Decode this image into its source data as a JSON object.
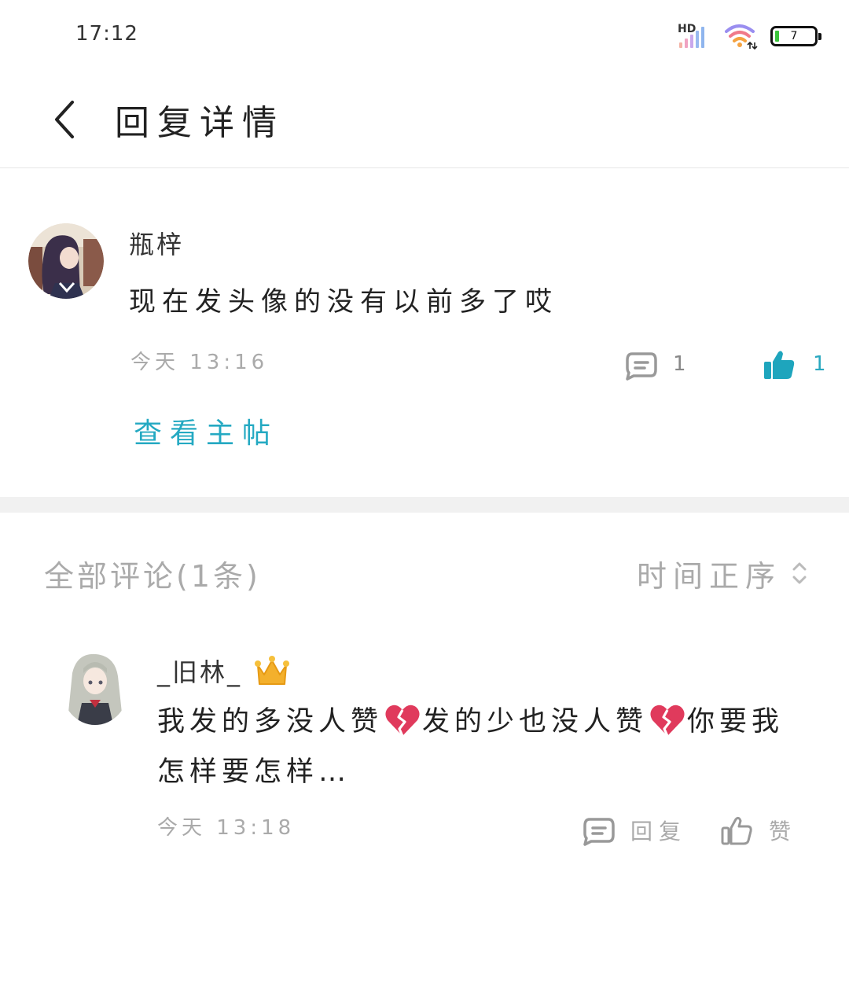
{
  "status_bar": {
    "time": "17:12",
    "network": "HD",
    "battery": "7"
  },
  "header": {
    "title": "回复详情"
  },
  "reply": {
    "author": "瓶梓",
    "text": "现在发头像的没有以前多了哎",
    "time": "今天 13:16",
    "comment_count": "1",
    "like_count": "1",
    "view_main_post": "查看主帖"
  },
  "comments_section": {
    "heading": "全部评论(1条)",
    "sort": "时间正序"
  },
  "comments": [
    {
      "author": "_旧林_",
      "badge_icon": "crown-icon",
      "text_part1": "我发的多没人赞",
      "text_part2": "发的少也没人赞",
      "text_part3": "你要我怎样要怎样…",
      "emoji_icon": "broken-heart-icon",
      "time": "今天 13:18",
      "reply_label": "回复",
      "like_label": "赞"
    }
  ],
  "colors": {
    "accent": "#24a9c2",
    "like_active": "#1ea5bd",
    "muted_text": "#aaaaaa",
    "divider": "#f1f1f1"
  }
}
